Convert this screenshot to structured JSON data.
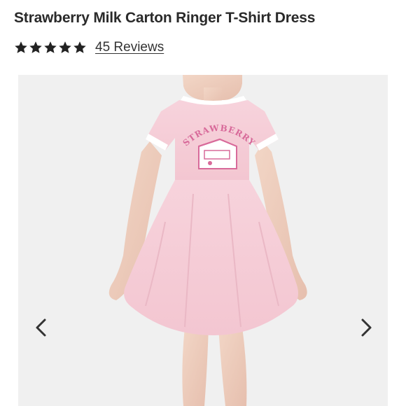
{
  "product": {
    "title": "Strawberry Milk Carton Ringer T-Shirt Dress",
    "rating": 5,
    "rating_max": 5,
    "reviews_label": "45 Reviews"
  },
  "gallery": {
    "image_subject": "model-in-pink-ringer-tshirt-dress",
    "graphic_text": "STRAWBERRY",
    "background_color": "#f0f0f0",
    "dress_color": "#f6cfd8",
    "trim_color": "#ffffff",
    "print_color": "#d86a9a",
    "prev_icon": "chevron-left-icon",
    "next_icon": "chevron-right-icon"
  },
  "colors": {
    "text": "#2a2a2a",
    "star": "#222222"
  }
}
